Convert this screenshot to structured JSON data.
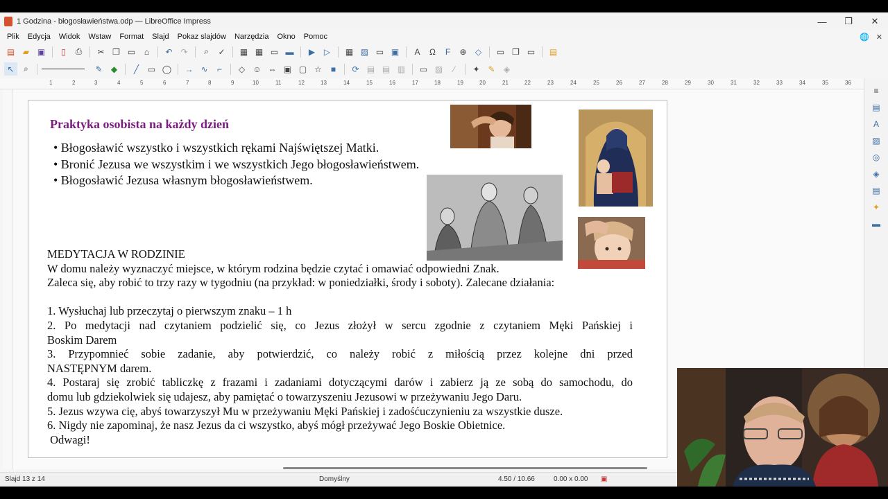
{
  "window": {
    "title": "1 Godzina - błogosławieństwa.odp — LibreOffice Impress",
    "minimize": "—",
    "maximize": "❐",
    "close": "✕"
  },
  "menu": {
    "items": [
      "Plik",
      "Edycja",
      "Widok",
      "Wstaw",
      "Format",
      "Slajd",
      "Pokaz slajdów",
      "Narzędzia",
      "Okno",
      "Pomoc"
    ]
  },
  "ruler": {
    "numbers": [
      "1",
      "2",
      "3",
      "4",
      "5",
      "6",
      "7",
      "8",
      "9",
      "10",
      "11",
      "12",
      "13",
      "14",
      "15",
      "16",
      "17",
      "18",
      "19",
      "20",
      "21",
      "22",
      "23",
      "24",
      "25",
      "26",
      "27",
      "28",
      "29",
      "30",
      "31",
      "32",
      "33",
      "34",
      "35",
      "36"
    ]
  },
  "slide": {
    "title": "Praktyka osobista na każdy dzień",
    "bullets": [
      "• Błogosławić wszystko i wszystkich rękami Najświętszej Matki.",
      "• Bronić Jezusa we wszystkim i we wszystkich Jego błogosławieństwem.",
      "• Błogosławić Jezusa własnym błogosławieństwem."
    ],
    "heading": "MEDYTACJA W RODZINIE",
    "intro1": "W domu należy wyznaczyć miejsce, w którym rodzina będzie czytać i omawiać odpowiedni Znak.",
    "intro2": "Zaleca się, aby robić to trzy razy w tygodniu (na przykład: w poniedziałki, środy i soboty). Zalecane działania:",
    "item1": "1. Wysłuchaj lub przeczytaj o pierwszym znaku – 1 h",
    "item2a": "2. Po medytacji nad czytaniem podzielić się, co Jezus złożył w sercu zgodnie z czytaniem Męki Pańskiej i",
    "item2b": "Boskim Darem",
    "item3a": "3. Przypomnieć sobie zadanie, aby potwierdzić, co należy robić z miłością przez kolejne dni przed",
    "item3b": "NASTĘPNYM darem.",
    "item4a": "4. Postaraj się zrobić tabliczkę z frazami i zadaniami dotyczącymi darów i zabierz ją ze sobą do samochodu, do",
    "item4b": "domu lub gdziekolwiek się udajesz, aby pamiętać o towarzyszeniu Jezusowi w przeżywaniu Jego Daru.",
    "item5": "5. Jezus wzywa cię, abyś towarzyszył Mu w przeżywaniu Męki Pańskiej i zadośćuczynieniu za wszystkie dusze.",
    "item6": "6. Nigdy nie zapominaj, że nasz Jezus da ci wszystko, abyś mógł przeżywać Jego Boskie Obietnice.",
    "closing": " Odwagi!"
  },
  "status": {
    "slide": "Slajd 13 z 14",
    "layout": "Domyślny",
    "position": "4.50 / 10.66",
    "size": "0.00 x 0.00"
  },
  "colors": {
    "title": "#7a1d7f",
    "accent": "#3b6ea5"
  }
}
